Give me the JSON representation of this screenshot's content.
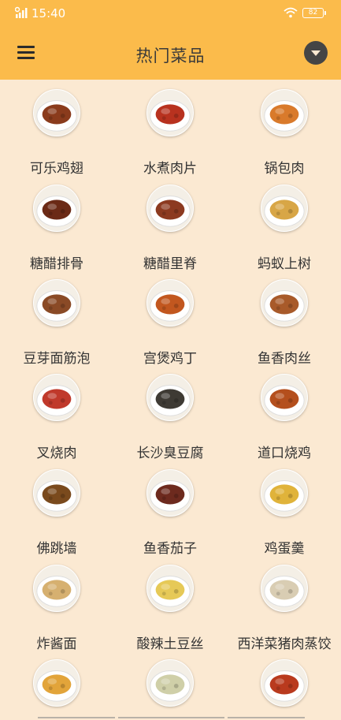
{
  "status_bar": {
    "time": "15:40",
    "battery": "82"
  },
  "header": {
    "title": "热门菜品",
    "menu_icon": "hamburger-menu-icon",
    "dropdown_icon": "chevron-down-icon"
  },
  "colors": {
    "app_bar": "#fbbb4b",
    "background": "#fbe9d2",
    "label_text": "#333333"
  },
  "dishes": [
    {
      "name": "可乐鸡翅",
      "tone": "#8a3b1c"
    },
    {
      "name": "水煮肉片",
      "tone": "#b8321f"
    },
    {
      "name": "锅包肉",
      "tone": "#d97a2b"
    },
    {
      "name": "糖醋排骨",
      "tone": "#6b2a16"
    },
    {
      "name": "糖醋里脊",
      "tone": "#8c3a20"
    },
    {
      "name": "蚂蚁上树",
      "tone": "#d8a646"
    },
    {
      "name": "豆芽面筋泡",
      "tone": "#8a4a26"
    },
    {
      "name": "宫煲鸡丁",
      "tone": "#c2571f"
    },
    {
      "name": "鱼香肉丝",
      "tone": "#a85a2a"
    },
    {
      "name": "叉烧肉",
      "tone": "#c0392b"
    },
    {
      "name": "长沙臭豆腐",
      "tone": "#3e3a34"
    },
    {
      "name": "道口烧鸡",
      "tone": "#b44f1d"
    },
    {
      "name": "佛跳墙",
      "tone": "#7a4a1d"
    },
    {
      "name": "鱼香茄子",
      "tone": "#6d2a1e"
    },
    {
      "name": "鸡蛋羹",
      "tone": "#e0b33a"
    },
    {
      "name": "炸酱面",
      "tone": "#d6b070"
    },
    {
      "name": "酸辣土豆丝",
      "tone": "#e6c957"
    },
    {
      "name": "西洋菜猪肉蒸饺",
      "tone": "#d9cdb3"
    },
    {
      "name": "",
      "tone": "#e2a43a"
    },
    {
      "name": "",
      "tone": "#cfcfa8"
    },
    {
      "name": "",
      "tone": "#b93a1e"
    }
  ]
}
